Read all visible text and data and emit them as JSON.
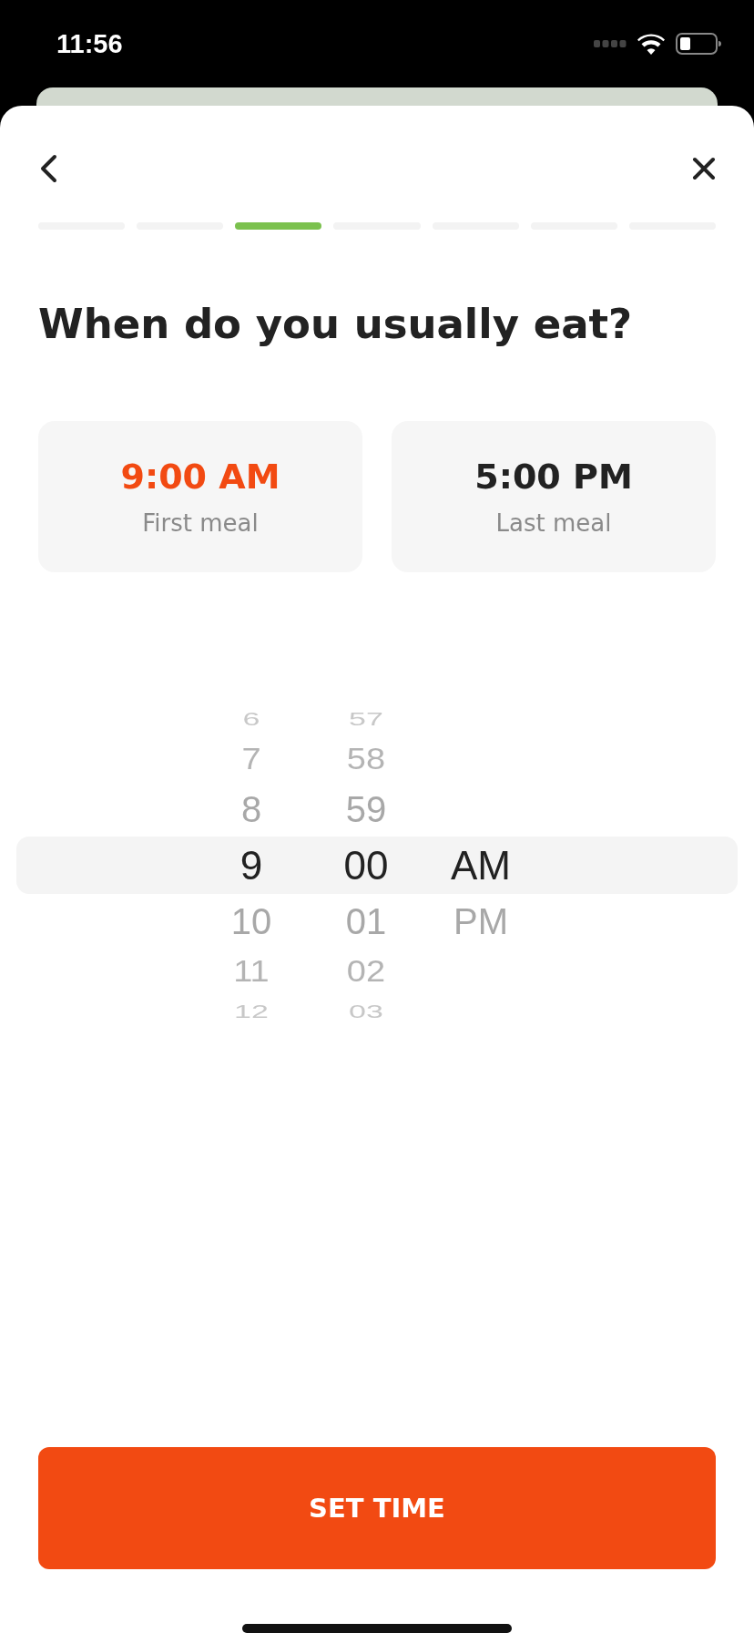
{
  "status_bar": {
    "time": "11:56"
  },
  "steps": [
    {
      "active": false
    },
    {
      "active": false
    },
    {
      "active": true
    },
    {
      "active": false
    },
    {
      "active": false
    },
    {
      "active": false
    },
    {
      "active": false
    }
  ],
  "title": "When do you usually eat?",
  "meals": [
    {
      "time": "9:00 AM",
      "label": "First meal",
      "selected": true
    },
    {
      "time": "5:00 PM",
      "label": "Last meal",
      "selected": false
    }
  ],
  "picker": {
    "columns": [
      {
        "items": [
          {
            "text": "6",
            "selected": false
          },
          {
            "text": "7",
            "selected": false
          },
          {
            "text": "8",
            "selected": false
          },
          {
            "text": "9",
            "selected": true
          },
          {
            "text": "10",
            "selected": false
          },
          {
            "text": "11",
            "selected": false
          },
          {
            "text": "12",
            "selected": false
          }
        ]
      },
      {
        "items": [
          {
            "text": "57",
            "selected": false
          },
          {
            "text": "58",
            "selected": false
          },
          {
            "text": "59",
            "selected": false
          },
          {
            "text": "00",
            "selected": true
          },
          {
            "text": "01",
            "selected": false
          },
          {
            "text": "02",
            "selected": false
          },
          {
            "text": "03",
            "selected": false
          }
        ]
      },
      {
        "items": [
          {
            "text": "AM",
            "selected": true
          },
          {
            "text": "PM",
            "selected": false
          }
        ]
      }
    ]
  },
  "button": {
    "label": "SET TIME"
  }
}
